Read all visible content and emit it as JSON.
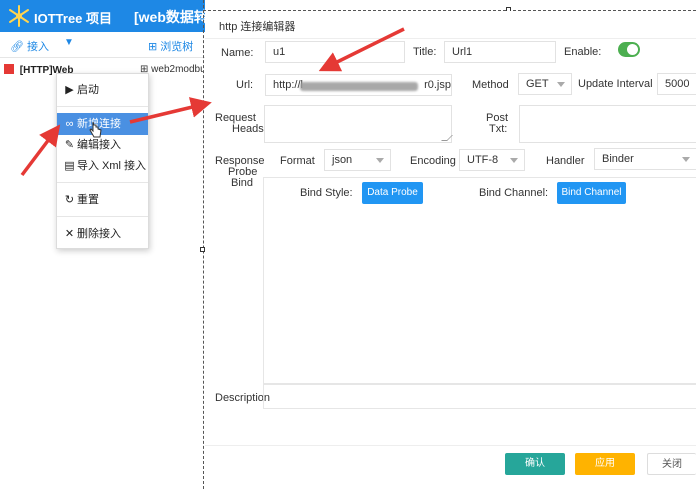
{
  "app": {
    "title": "IOTTree 项目",
    "project_title": "[web数据转"
  },
  "toolbar": {
    "connect_label": "接入",
    "browse_label": "浏览树"
  },
  "tree": {
    "node_label": "[HTTP]Web",
    "node2_label": "web2modbu"
  },
  "context_menu": {
    "items": [
      {
        "icon": "play-icon",
        "label": "启动"
      },
      {
        "icon": "link-icon",
        "label": "新增连接"
      },
      {
        "icon": "pencil-icon",
        "label": "编辑接入"
      },
      {
        "icon": "file-icon",
        "label": "导入 Xml 接入"
      },
      {
        "icon": "refresh-icon",
        "label": "重置"
      },
      {
        "icon": "close-icon",
        "label": "删除接入"
      }
    ]
  },
  "dialog": {
    "title": "http 连接编辑器",
    "name_label": "Name:",
    "name_value": "u1",
    "title_label": "Title:",
    "title_value": "Url1",
    "enable_label": "Enable:",
    "enable_on": true,
    "url_label": "Url:",
    "url_prefix": "http://l",
    "url_suffix": "r0.jsp",
    "method_label": "Method",
    "method_value": "GET",
    "update_interval_label": "Update Interval",
    "update_interval_value": "5000",
    "request_heads_label_1": "Request",
    "request_heads_label_2": "Heads:",
    "post_txt_label_1": "Post",
    "post_txt_label_2": "Txt:",
    "response_label_1": "Response",
    "response_label_2": "Probe",
    "response_label_3": "Bind",
    "format_label": "Format",
    "format_value": "json",
    "encoding_label": "Encoding",
    "encoding_value": "UTF-8",
    "handler_label": "Handler",
    "handler_value": "Binder",
    "bind_style_label": "Bind Style:",
    "data_probe_button": "Data Probe",
    "bind_channel_label": "Bind Channel:",
    "bind_channel_button": "Bind Channel",
    "description_label": "Description",
    "confirm_button": "确认",
    "apply_button": "应用",
    "close_button": "关闭"
  },
  "colors": {
    "brand_blue": "#1e88e5",
    "menu_highlight": "#4a90e2",
    "toggle_green": "#4caf50",
    "confirm_teal": "#26a69a",
    "apply_amber": "#ffb300",
    "action_blue": "#2196f3",
    "annotation_red": "#e53935"
  }
}
